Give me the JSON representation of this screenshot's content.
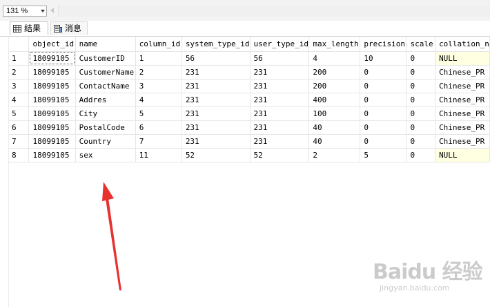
{
  "toolbar": {
    "zoom": "131 %"
  },
  "tabs": [
    {
      "label": "结果",
      "icon": "grid-icon"
    },
    {
      "label": "消息",
      "icon": "message-icon"
    }
  ],
  "grid": {
    "columns": [
      "object_id",
      "name",
      "column_id",
      "system_type_id",
      "user_type_id",
      "max_length",
      "precision",
      "scale",
      "collation_n"
    ],
    "rows": [
      [
        "1",
        "18099105",
        "CustomerID",
        "1",
        "56",
        "56",
        "4",
        "10",
        "0",
        "NULL"
      ],
      [
        "2",
        "18099105",
        "CustomerName",
        "2",
        "231",
        "231",
        "200",
        "0",
        "0",
        "Chinese_PR"
      ],
      [
        "3",
        "18099105",
        "ContactName",
        "3",
        "231",
        "231",
        "200",
        "0",
        "0",
        "Chinese_PR"
      ],
      [
        "4",
        "18099105",
        "Addres",
        "4",
        "231",
        "231",
        "400",
        "0",
        "0",
        "Chinese_PR"
      ],
      [
        "5",
        "18099105",
        "City",
        "5",
        "231",
        "231",
        "100",
        "0",
        "0",
        "Chinese_PR"
      ],
      [
        "6",
        "18099105",
        "PostalCode",
        "6",
        "231",
        "231",
        "40",
        "0",
        "0",
        "Chinese_PR"
      ],
      [
        "7",
        "18099105",
        "Country",
        "7",
        "231",
        "231",
        "40",
        "0",
        "0",
        "Chinese_PR"
      ],
      [
        "8",
        "18099105",
        "sex",
        "11",
        "52",
        "52",
        "2",
        "5",
        "0",
        "NULL"
      ]
    ]
  },
  "watermark": {
    "title": "Baidu 经验",
    "subtitle": "jingyan.baidu.com"
  },
  "colors": {
    "null_cell": "#ffffe1",
    "arrow": "#e8322f"
  }
}
